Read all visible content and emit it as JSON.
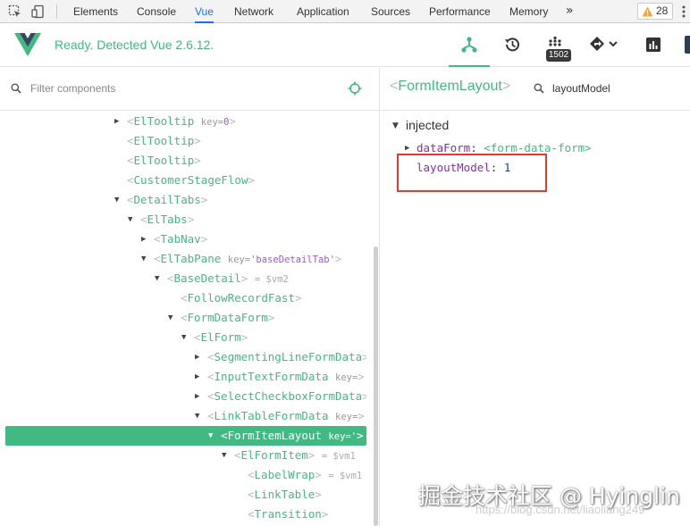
{
  "devtools": {
    "tabs": [
      "Elements",
      "Console",
      "Vue",
      "Network",
      "Application",
      "Sources",
      "Performance",
      "Memory"
    ],
    "active_tab": "Vue",
    "more_label": "»",
    "warning_count": "28",
    "colors": {
      "active_tab": "#1a73e8",
      "warning": "#f9a825"
    }
  },
  "vue_header": {
    "status": "Ready. Detected Vue 2.6.12.",
    "buttons": [
      "components-icon",
      "history-icon",
      "vuex-icon",
      "routing-icon",
      "performance-icon"
    ],
    "vuex_badge": "1502",
    "accent_color": "#42b983"
  },
  "tree_filter": {
    "placeholder": "Filter components"
  },
  "tree": [
    {
      "arrow": "▶",
      "name": "ElTooltip",
      "key_label": "key=",
      "key_value": "0"
    },
    {
      "arrow": "",
      "name": "ElTooltip"
    },
    {
      "arrow": "",
      "name": "ElTooltip"
    },
    {
      "arrow": "",
      "name": "CustomerStageFlow"
    },
    {
      "arrow": "▼",
      "name": "DetailTabs"
    },
    {
      "arrow": "▼",
      "name": "ElTabs"
    },
    {
      "arrow": "▶",
      "name": "TabNav"
    },
    {
      "arrow": "▼",
      "name": "ElTabPane",
      "key_label": "key=",
      "key_value": "'baseDetailTab'"
    },
    {
      "arrow": "▼",
      "name": "BaseDetail",
      "vm": "= $vm2"
    },
    {
      "arrow": "",
      "name": "FollowRecordFast"
    },
    {
      "arrow": "▼",
      "name": "FormDataForm"
    },
    {
      "arrow": "▼",
      "name": "ElForm"
    },
    {
      "arrow": "▶",
      "name": "SegmentingLineFormData"
    },
    {
      "arrow": "▶",
      "name": "InputTextFormData",
      "key_label": "key=",
      "key_value": ""
    },
    {
      "arrow": "▶",
      "name": "SelectCheckboxFormData"
    },
    {
      "arrow": "▼",
      "name": "LinkTableFormData",
      "key_label": "key=",
      "key_value": ""
    },
    {
      "arrow": "▼",
      "name": "FormItemLayout",
      "key_label": "key=",
      "key_value": "'"
    },
    {
      "arrow": "▼",
      "name": "ElFormItem",
      "vm": "= $vm1"
    },
    {
      "arrow": "",
      "name": "LabelWrap",
      "vm": "= $vm1"
    },
    {
      "arrow": "",
      "name": "LinkTable"
    },
    {
      "arrow": "",
      "name": "Transition"
    }
  ],
  "inspector": {
    "component_name": "FormItemLayout",
    "filter_value": "layoutModel",
    "section_label": "injected",
    "props": [
      {
        "key": "dataForm",
        "value": "<form-data-form>",
        "type": "component"
      },
      {
        "key": "layoutModel",
        "value": "1",
        "type": "number"
      }
    ]
  },
  "watermark": {
    "text": "掘金技术社区 @ Hyinglin",
    "url": "https://blog.csdn.net/liaoliang249"
  }
}
